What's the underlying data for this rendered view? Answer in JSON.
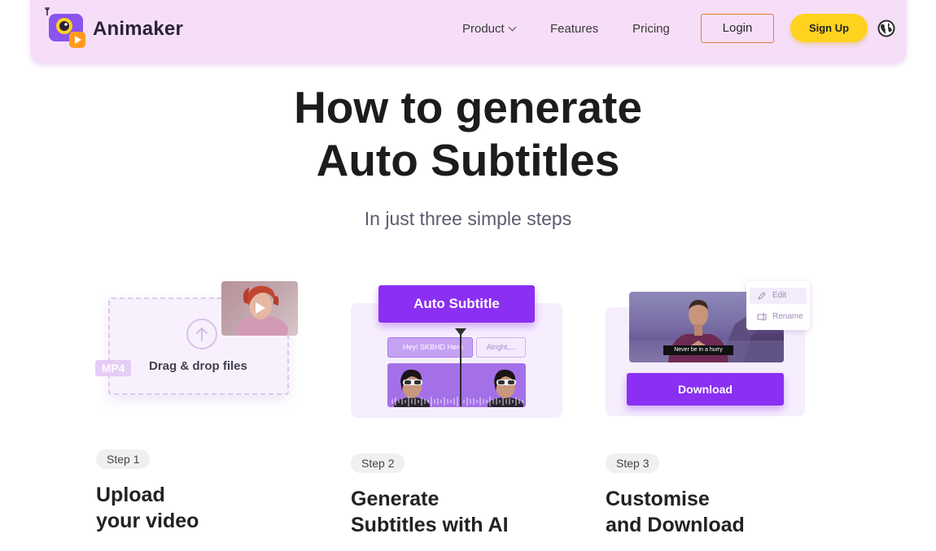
{
  "nav": {
    "brand": "Animaker",
    "links": [
      {
        "label": "Product",
        "has_dropdown": true
      },
      {
        "label": "Features"
      },
      {
        "label": "Pricing"
      }
    ],
    "login_label": "Login",
    "signup_label": "Sign Up",
    "icons": {
      "logo": "animaker-logo-icon",
      "language": "globe-icon"
    }
  },
  "hero": {
    "title_line1": "How to generate",
    "title_line2": "Auto Subtitles",
    "subtitle": "In just three simple steps"
  },
  "step1_illustration": {
    "drag_text": "Drag & drop files",
    "format_badge": "MP4",
    "icons": [
      "upload-arrow-icon",
      "play-icon"
    ]
  },
  "step2_illustration": {
    "button_label": "Auto Subtitle",
    "subtitle_chip_1": "Hey! SKBHD Here",
    "subtitle_chip_2": "Alright,..."
  },
  "step3_illustration": {
    "caption": "Never be in a hurry",
    "menu_edit": "Edit",
    "menu_rename": "Rename",
    "download_label": "Download"
  },
  "steps": [
    {
      "badge": "Step 1",
      "title_line1": "Upload",
      "title_line2": "your video"
    },
    {
      "badge": "Step 2",
      "title_line1": "Generate",
      "title_line2": "Subtitles with AI"
    },
    {
      "badge": "Step 3",
      "title_line1": "Customise",
      "title_line2": "and Download"
    }
  ],
  "colors": {
    "nav_bg": "#f6def9",
    "accent_purple": "#8b2ff2",
    "signup_yellow": "#ffd21f",
    "login_border": "#e27d3a"
  }
}
